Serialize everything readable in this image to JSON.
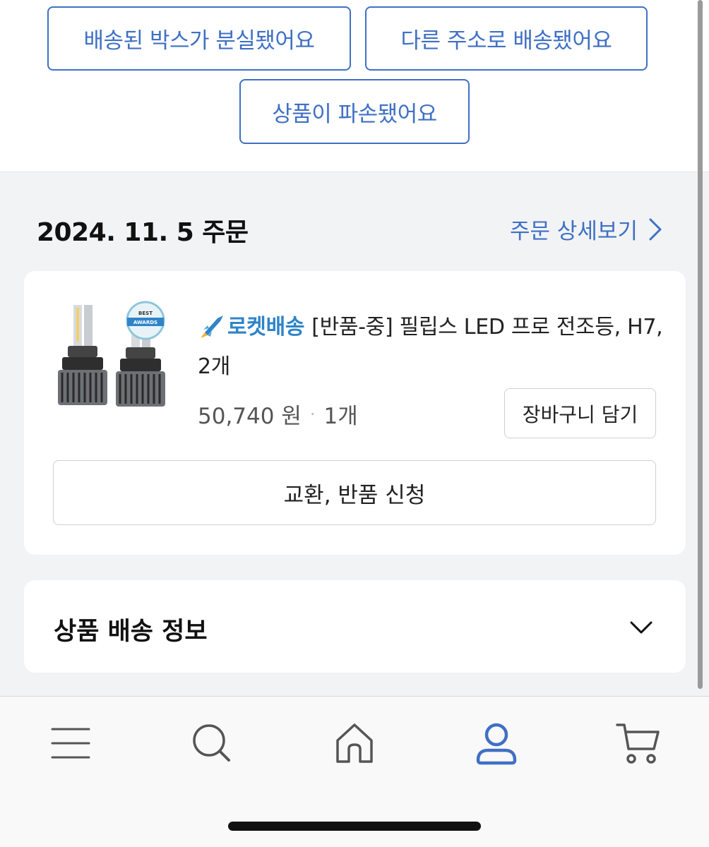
{
  "reasons": {
    "lost_box": "배송된 박스가 분실됐어요",
    "wrong_address": "다른 주소로 배송됐어요",
    "damaged": "상품이 파손됐어요"
  },
  "order": {
    "date_label": "2024. 11. 5 주문",
    "detail_link": "주문 상세보기"
  },
  "product": {
    "delivery_badge": "로켓배송",
    "title": "[반품-중] 필립스 LED 프로 전조등, H7, 2개",
    "price": "50,740 원",
    "separator": "·",
    "quantity": "1개",
    "cart_button": "장바구니 담기",
    "exchange_button": "교환, 반품 신청",
    "thumbnail_badge_text": "BEST AWARDS"
  },
  "shipping": {
    "title": "상품 배송 정보"
  },
  "nav": {
    "items": [
      {
        "icon": "menu-icon"
      },
      {
        "icon": "search-icon"
      },
      {
        "icon": "home-icon"
      },
      {
        "icon": "user-icon",
        "active": true
      },
      {
        "icon": "cart-icon"
      }
    ]
  },
  "colors": {
    "accent": "#3f70c4",
    "rocket": "#2f84c8",
    "background": "#f2f3f5"
  }
}
